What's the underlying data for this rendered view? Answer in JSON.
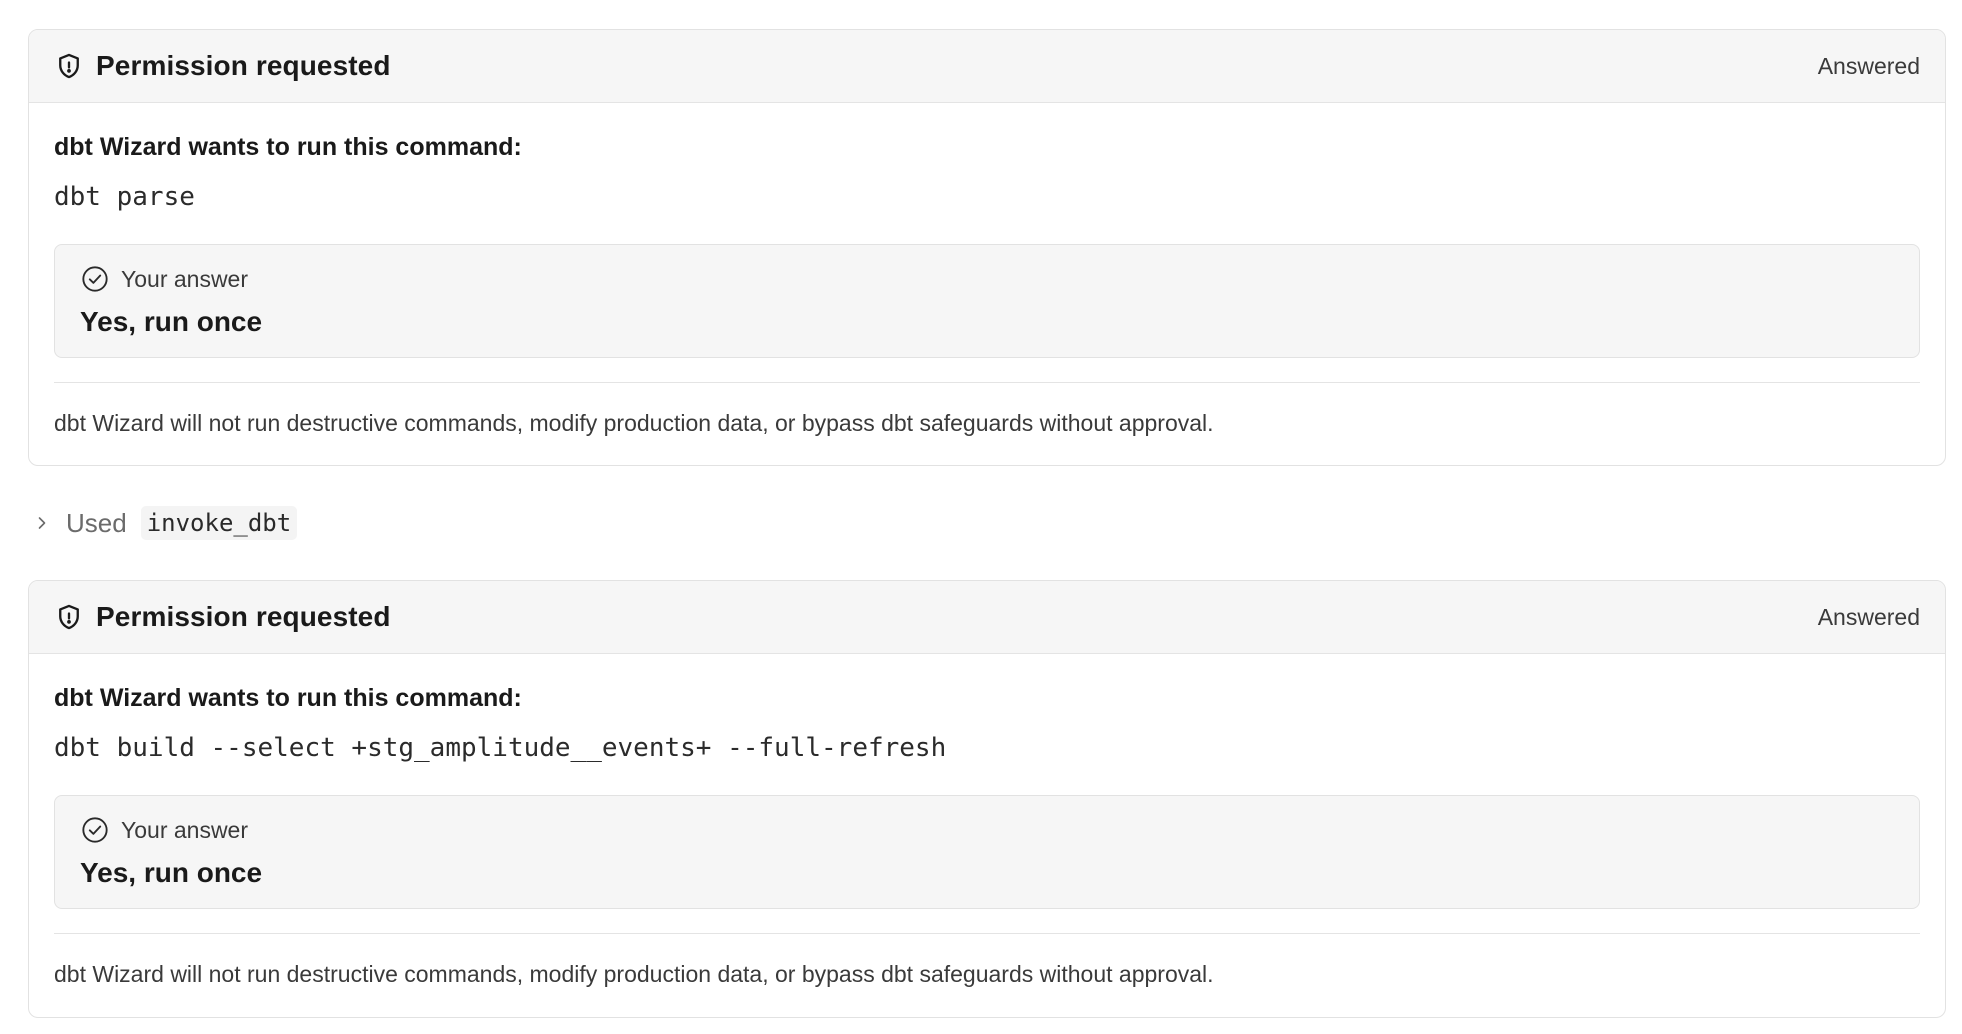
{
  "permission_cards": [
    {
      "title": "Permission requested",
      "status": "Answered",
      "prompt": "dbt Wizard wants to run this command:",
      "command": "dbt parse",
      "answer_label": "Your answer",
      "answer_value": "Yes, run once",
      "notice": "dbt Wizard will not run destructive commands, modify production data, or bypass dbt safeguards without approval."
    },
    {
      "title": "Permission requested",
      "status": "Answered",
      "prompt": "dbt Wizard wants to run this command:",
      "command": "dbt build --select +stg_amplitude__events+ --full-refresh",
      "answer_label": "Your answer",
      "answer_value": "Yes, run once",
      "notice": "dbt Wizard will not run destructive commands, modify production data, or bypass dbt safeguards without approval."
    }
  ],
  "tool_usage": {
    "label": "Used",
    "tool_name": "invoke_dbt"
  },
  "icons": {
    "header": "shield-icon",
    "answer": "check-circle-icon",
    "expand": "chevron-right-icon"
  },
  "colors": {
    "header_background": "#f6f6f6",
    "border": "#e2e2e2",
    "text_primary": "#1a1a1a",
    "text_secondary": "#3a3a3a",
    "text_muted": "#6b6b6b"
  }
}
